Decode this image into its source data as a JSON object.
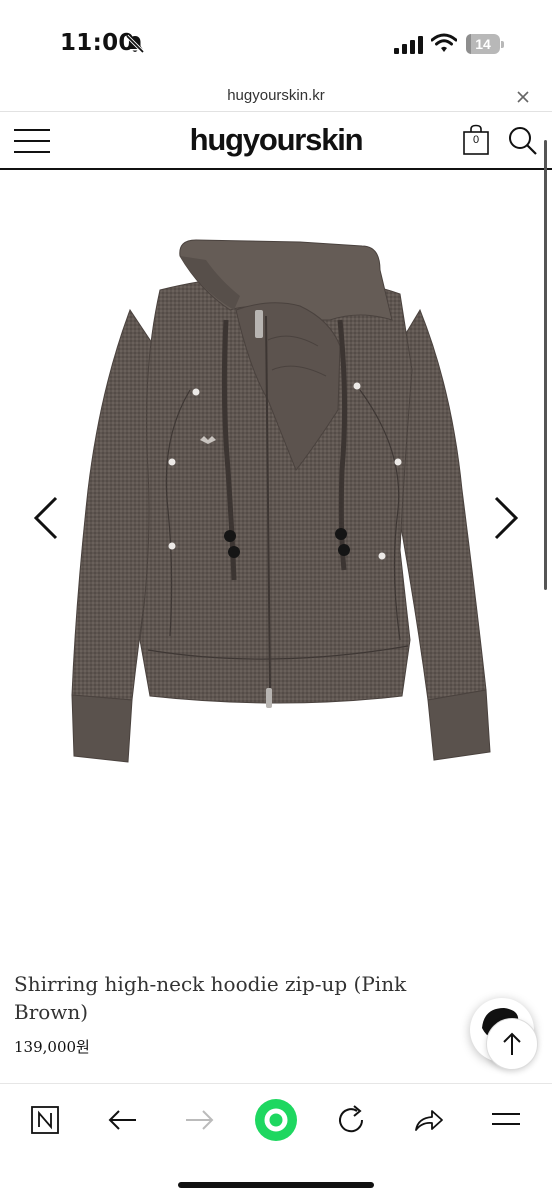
{
  "status_bar": {
    "time": "11:00",
    "battery_level": "14"
  },
  "browser": {
    "url": "hugyourskin.kr"
  },
  "header": {
    "logo": "hugyourskin",
    "cart_count": "0"
  },
  "product": {
    "title": "Shirring high-neck hoodie zip-up (Pink Brown)",
    "price": "139,000원"
  },
  "colors": {
    "hoodie": "#5e5550",
    "accent_green": "#1ed760"
  }
}
